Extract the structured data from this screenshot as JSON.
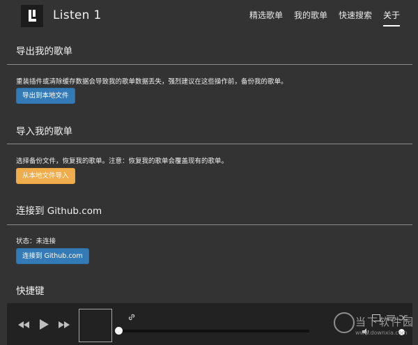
{
  "header": {
    "app_title": "Listen 1",
    "nav": [
      "精选歌单",
      "我的歌单",
      "快速搜索",
      "关于"
    ],
    "active_nav": "关于"
  },
  "export_section": {
    "title": "导出我的歌单",
    "description": "重装插件或清除缓存数据会导致我的歌单数据丢失，强烈建议在这些操作前，备份我的歌单。",
    "button_label": "导出到本地文件"
  },
  "import_section": {
    "title": "导入我的歌单",
    "description": "选择备份文件，恢复我的歌单。注意：恢复我的歌单会覆盖现有的歌单。",
    "button_label": "从本地文件导入"
  },
  "github_section": {
    "title": "连接到 Github.com",
    "status": "状态：未连接",
    "button_label": "连接到 Github.com"
  },
  "shortcuts_section": {
    "title": "快捷键"
  },
  "player": {
    "progress": 0,
    "icons": [
      "prev-icon",
      "play-icon",
      "next-icon",
      "link-icon",
      "window-icon",
      "playlist-icon",
      "shuffle-icon",
      "volume-icon"
    ]
  },
  "watermark": {
    "text": "当下软件园",
    "sub": "www.downxia.com"
  },
  "colors": {
    "background": "#333333",
    "primary_button": "#337ab7",
    "warning_button": "#f0ad4e",
    "player_bar": "#222222"
  }
}
